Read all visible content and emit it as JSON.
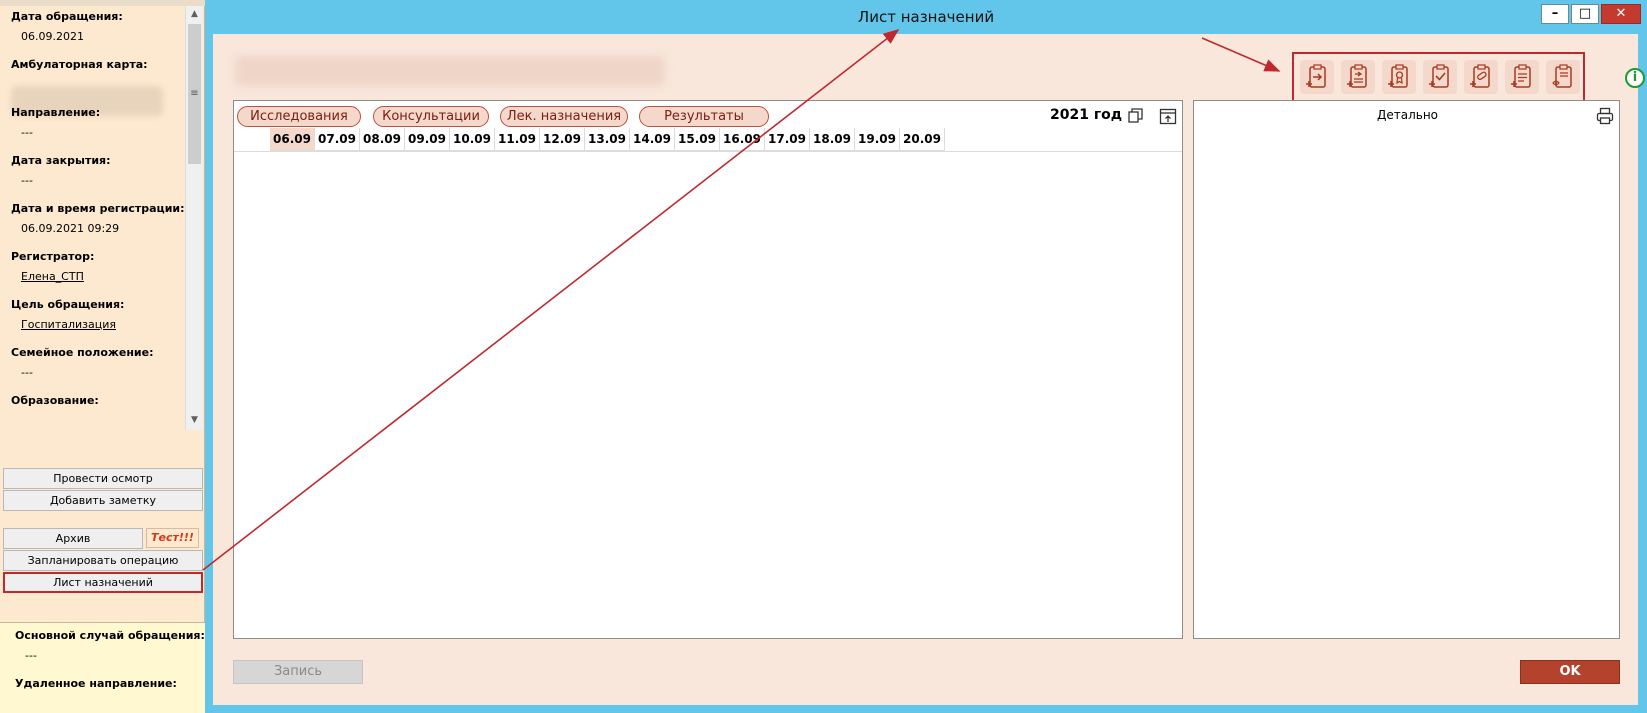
{
  "left_panel": {
    "fields": [
      {
        "label": "Дата обращения:",
        "value": "06.09.2021"
      },
      {
        "label": "Амбулаторная карта:",
        "value": ""
      },
      {
        "label": "Направление:",
        "value": "---"
      },
      {
        "label": "Дата закрытия:",
        "value": "---"
      },
      {
        "label": "Дата и время регистрации:",
        "value": "06.09.2021 09:29"
      },
      {
        "label": "Регистратор:",
        "value": "Елена_СТП"
      },
      {
        "label": "Цель обращения:",
        "value": "Госпитализация"
      },
      {
        "label": "Семейное положение:",
        "value": "---"
      },
      {
        "label": "Образование:",
        "value": ""
      }
    ],
    "buttons": {
      "exam": "Провести осмотр",
      "note": "Добавить заметку",
      "archive": "Архив",
      "test_badge": "Тест!!!",
      "plan_operation": "Запланировать операцию",
      "prescriptions": "Лист назначений"
    },
    "bottom_fields": [
      {
        "label": "Основной случай обращения:",
        "value": "---"
      },
      {
        "label": "Удаленное направление:",
        "value": ""
      }
    ]
  },
  "dialog": {
    "title": "Лист назначений",
    "window_buttons": {
      "minimize": "–",
      "maximize": "□",
      "close": "✕"
    },
    "tabs": [
      "Исследования",
      "Консультации",
      "Лек. назначения",
      "Результаты"
    ],
    "year": "2021 год",
    "dates": [
      "06.09",
      "07.09",
      "08.09",
      "09.09",
      "10.09",
      "11.09",
      "12.09",
      "13.09",
      "14.09",
      "15.09",
      "16.09",
      "17.09",
      "18.09",
      "19.09",
      "20.09"
    ],
    "detail_title": "Детально",
    "record_button": "Запись",
    "ok_button": "OK",
    "info_glyph": "i"
  },
  "colors": {
    "left_bg": "#fde9cf",
    "dialog_frame": "#62c6ea",
    "dialog_body": "#f9e7dc",
    "accent": "#b3432d",
    "annotation_red": "#c0282e"
  }
}
